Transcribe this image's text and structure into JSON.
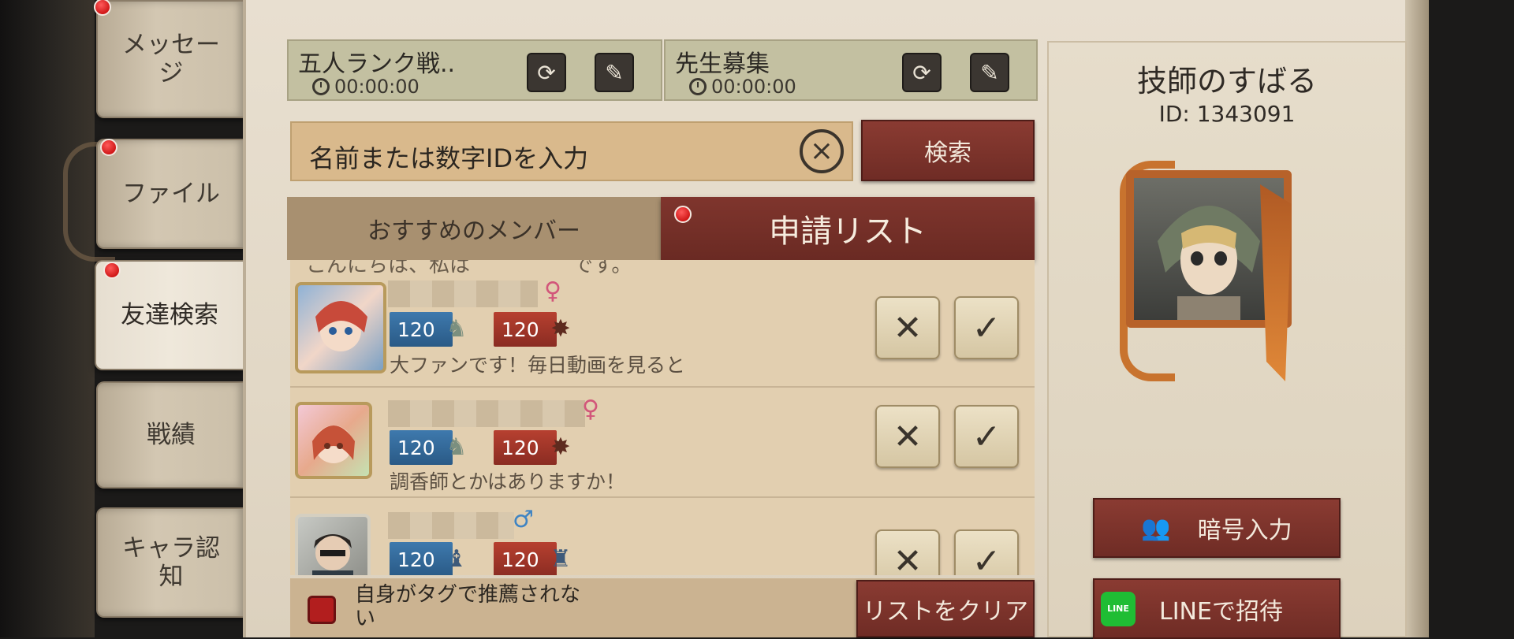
{
  "sidebar": {
    "tabs": [
      {
        "label": "メッセージ",
        "badge": true
      },
      {
        "label": "ファイル",
        "badge": true
      },
      {
        "label": "友達検索",
        "badge": true,
        "active": true
      },
      {
        "label": "戦績",
        "badge": false
      },
      {
        "label": "キャラ認知",
        "badge": false
      }
    ]
  },
  "team_slots": [
    {
      "name": "五人ランク戦..",
      "timer": "00:00:00"
    },
    {
      "name": "先生募集",
      "timer": "00:00:00"
    }
  ],
  "search": {
    "placeholder": "名前または数字IDを入力",
    "clear_icon": "×",
    "button_label": "検索"
  },
  "tabs": {
    "recommended": "おすすめのメンバー",
    "requests": "申請リスト",
    "requests_badge": true
  },
  "list": {
    "cut_row_text": "こんにちは、私は　　　　　です。",
    "rows": [
      {
        "gender": "♀",
        "survivor_rank": "120",
        "hunter_rank": "120",
        "message": "大ファンです！毎日動画を見ると"
      },
      {
        "gender": "♀",
        "survivor_rank": "120",
        "hunter_rank": "120",
        "message": "調香師とかはありますか！"
      },
      {
        "gender": "♂",
        "survivor_rank": "120",
        "hunter_rank": "120",
        "message": ""
      }
    ],
    "reject_icon": "✕",
    "accept_icon": "✓"
  },
  "bottom": {
    "checkbox_label": "自身がタグで推薦されない",
    "clear_button": "リストをクリア"
  },
  "profile": {
    "name": "技師のすばる",
    "id_text": "ID: 1343091",
    "code_button": "暗号入力",
    "line_button": "LINEで招待",
    "line_logo_text": "LINE"
  },
  "colors": {
    "accent_brown": "#7a3129",
    "badge_red": "#d01818",
    "line_green": "#1fbd34"
  }
}
